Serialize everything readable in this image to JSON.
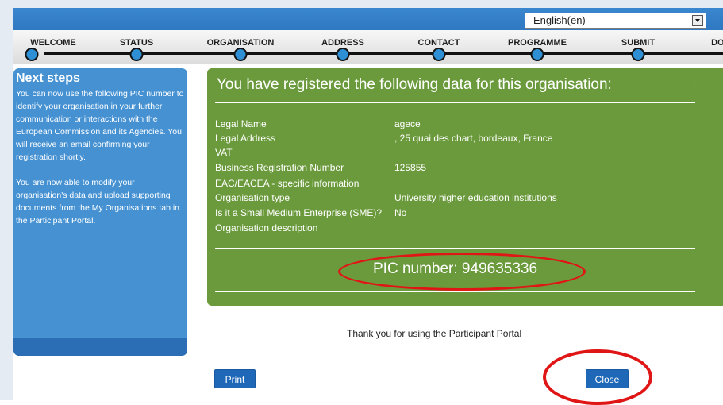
{
  "language_selector": {
    "value": "English(en)"
  },
  "steps": [
    "WELCOME",
    "STATUS",
    "ORGANISATION",
    "ADDRESS",
    "CONTACT",
    "PROGRAMME",
    "SUBMIT",
    "DONE"
  ],
  "sidebar": {
    "title": "Next steps",
    "paragraph1": "You can now use the following PIC number to identify your organisation in your further communication or interactions with the European Commission and its Agencies. You will receive an email confirming your registration shortly.",
    "paragraph2": "You are now able to modify your organisation's data and upload supporting documents from the My Organisations tab in the Participant Portal."
  },
  "summary": {
    "title": "You have registered the following data for this organisation:",
    "fields": [
      {
        "label": "Legal Name",
        "value": "agece"
      },
      {
        "label": "Legal Address",
        "value": ", 25 quai des chart, bordeaux, France"
      },
      {
        "label": "VAT",
        "value": ""
      },
      {
        "label": "Business Registration Number",
        "value": "125855"
      },
      {
        "label": "EAC/EACEA - specific information",
        "value": ""
      },
      {
        "label": "Organisation type",
        "value": "University higher education institutions"
      },
      {
        "label": "Is it a Small Medium Enterprise (SME)?",
        "value": "No"
      },
      {
        "label": "Organisation description",
        "value": ""
      }
    ],
    "pic_number": "PIC number: 949635336"
  },
  "thank_you": "Thank you for using the Participant Portal",
  "buttons": {
    "print": "Print",
    "close": "Close"
  },
  "colors": {
    "brand_blue": "#2f78c2",
    "panel_green": "#6b9a3c",
    "annotation_red": "#e01616"
  }
}
